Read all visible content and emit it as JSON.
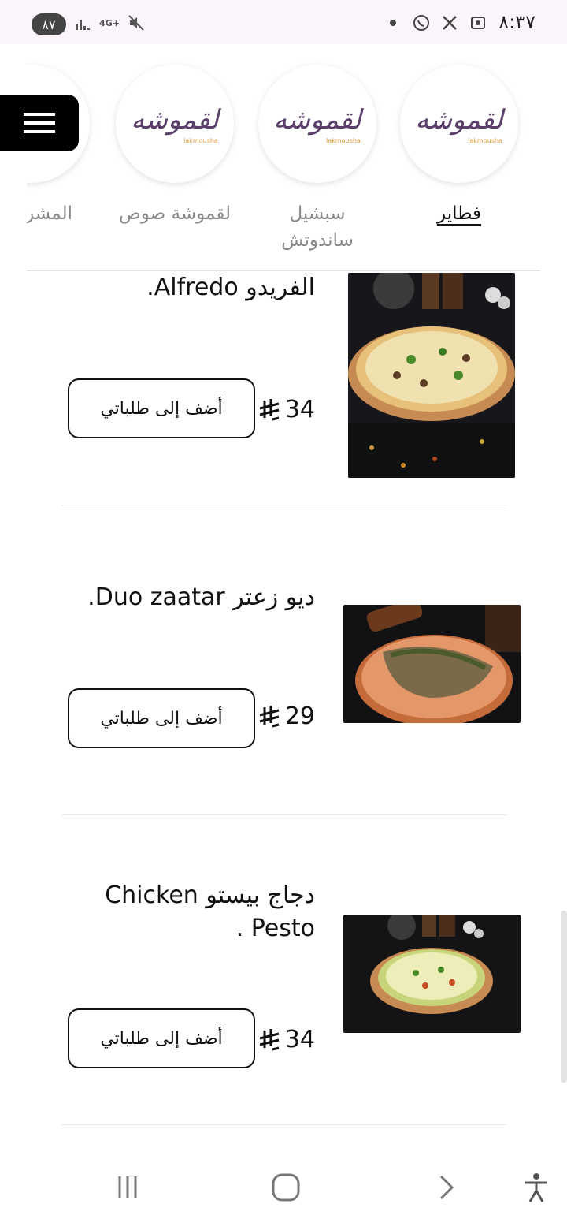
{
  "status": {
    "time": "٨:٣٧",
    "battery": "٨٧",
    "network": "4G+"
  },
  "categories": [
    {
      "label": "فطاير",
      "logo_text": "لقموشه",
      "logo_sub": "lakmousha",
      "active": true
    },
    {
      "label": "سبشيل ساندوتش",
      "logo_text": "لقموشه",
      "logo_sub": "lakmousha",
      "active": false
    },
    {
      "label": "لقموشة صوص",
      "logo_text": "لقموشه",
      "logo_sub": "lakmousha",
      "active": false
    },
    {
      "label": "المشروبات",
      "logo_text": "",
      "logo_sub": "",
      "active": false
    }
  ],
  "items": [
    {
      "title": "الفريدو Alfredo.",
      "price": "34",
      "add_label": "أضف إلى طلباتي"
    },
    {
      "title": "ديو زعتر Duo zaatar.",
      "price": "29",
      "add_label": "أضف إلى طلباتي"
    },
    {
      "title": "دجاج بيستو Chicken Pesto .",
      "price": "34",
      "add_label": "أضف إلى طلباتي"
    }
  ],
  "colors": {
    "brand_purple": "#5a3f6b",
    "brand_orange": "#e39a3c",
    "status_bg": "#fcf4fb"
  },
  "icons": {
    "menu": "hamburger-icon",
    "currency": "saudi-riyal-icon",
    "nav_recent": "recent-apps-icon",
    "nav_home": "home-icon",
    "nav_back": "back-icon",
    "accessibility": "accessibility-icon"
  }
}
